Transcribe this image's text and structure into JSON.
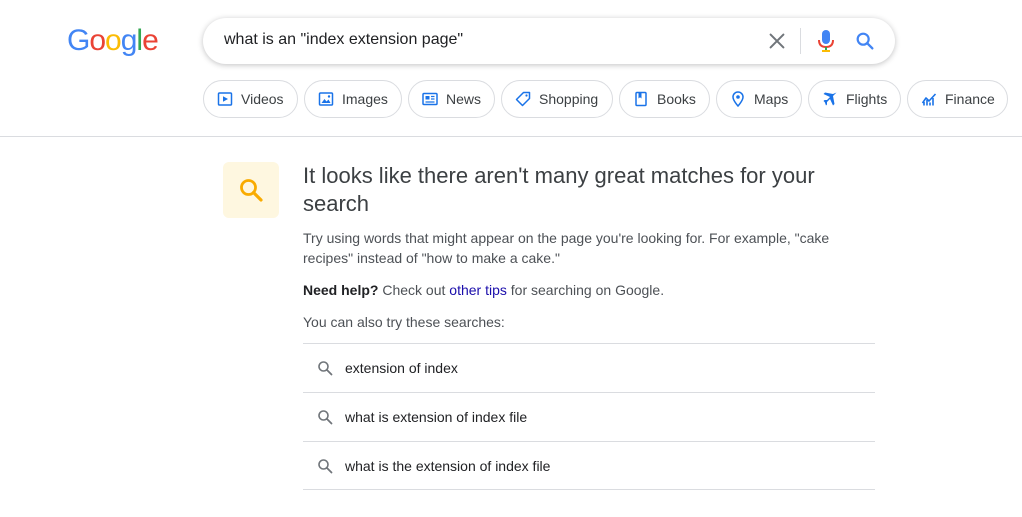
{
  "logo": {
    "letters": [
      "G",
      "o",
      "o",
      "g",
      "l",
      "e"
    ],
    "colors": [
      "#4285F4",
      "#EA4335",
      "#FBBC05",
      "#4285F4",
      "#34A853",
      "#EA4335"
    ]
  },
  "search": {
    "value": "what is an \"index extension page\""
  },
  "chips": [
    {
      "label": "Videos",
      "icon": "video-icon"
    },
    {
      "label": "Images",
      "icon": "image-icon"
    },
    {
      "label": "News",
      "icon": "news-icon"
    },
    {
      "label": "Shopping",
      "icon": "tag-icon"
    },
    {
      "label": "Books",
      "icon": "book-icon"
    },
    {
      "label": "Maps",
      "icon": "location-pin-icon"
    },
    {
      "label": "Flights",
      "icon": "airplane-icon"
    },
    {
      "label": "Finance",
      "icon": "chart-icon"
    }
  ],
  "results": {
    "headline": "It looks like there aren't many great matches for your search",
    "tip": "Try using words that might appear on the page you're looking for. For example, \"cake recipes\" instead of \"how to make a cake.\"",
    "help_bold": "Need help?",
    "help_pre": " Check out ",
    "help_link": "other tips",
    "help_post": " for searching on Google.",
    "also_label": "You can also try these searches:",
    "suggestions": [
      "extension of index",
      "what is extension of index file",
      "what is the extension of index file"
    ]
  },
  "colors": {
    "accent_blue": "#4285F4",
    "link": "#1a0dab",
    "tile_bg": "#fef7e0",
    "tile_icon": "#F9AB00"
  }
}
